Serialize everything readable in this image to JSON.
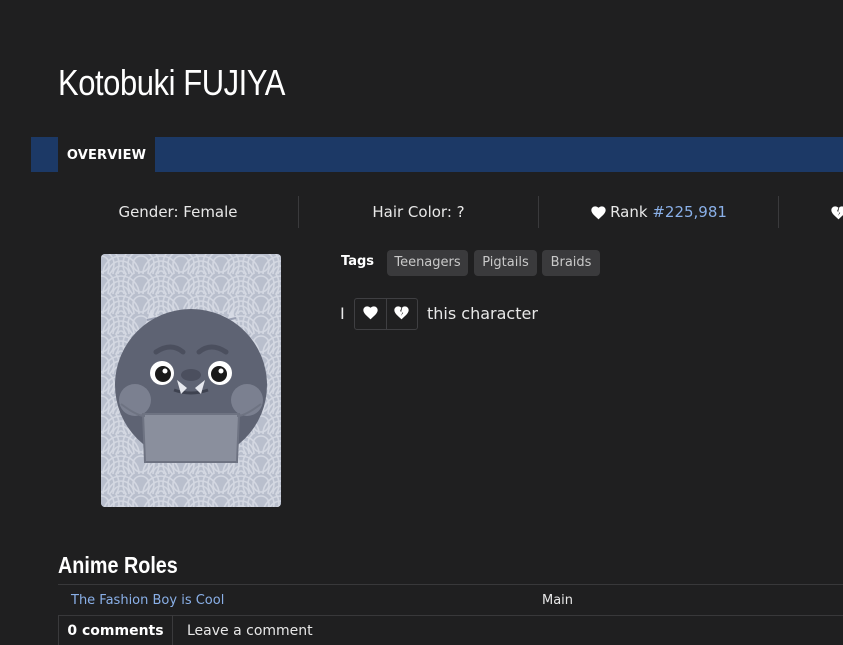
{
  "character": {
    "name": "Kotobuki FUJIYA"
  },
  "tabs": [
    {
      "label": "OVERVIEW"
    }
  ],
  "stats": {
    "gender": "Gender: Female",
    "hair_color": "Hair Color: ?",
    "rank_label": "Rank",
    "rank_value": "#225,981"
  },
  "tags": {
    "label": "Tags",
    "items": [
      "Teenagers",
      "Pigtails",
      "Braids"
    ]
  },
  "love": {
    "prefix": "I",
    "suffix": "this character",
    "love_icon": "heart-icon",
    "hate_icon": "broken-heart-icon"
  },
  "anime_roles": {
    "title": "Anime Roles",
    "rows": [
      {
        "anime": "The Fashion Boy is Cool",
        "role": "Main"
      }
    ]
  },
  "comments": {
    "count_label": "0 comments",
    "leave_label": "Leave a comment"
  },
  "colors": {
    "background": "#1f1f20",
    "tabbar": "#1c3966",
    "link": "#8ab0e8",
    "tag_bg": "#3a3a3c"
  }
}
